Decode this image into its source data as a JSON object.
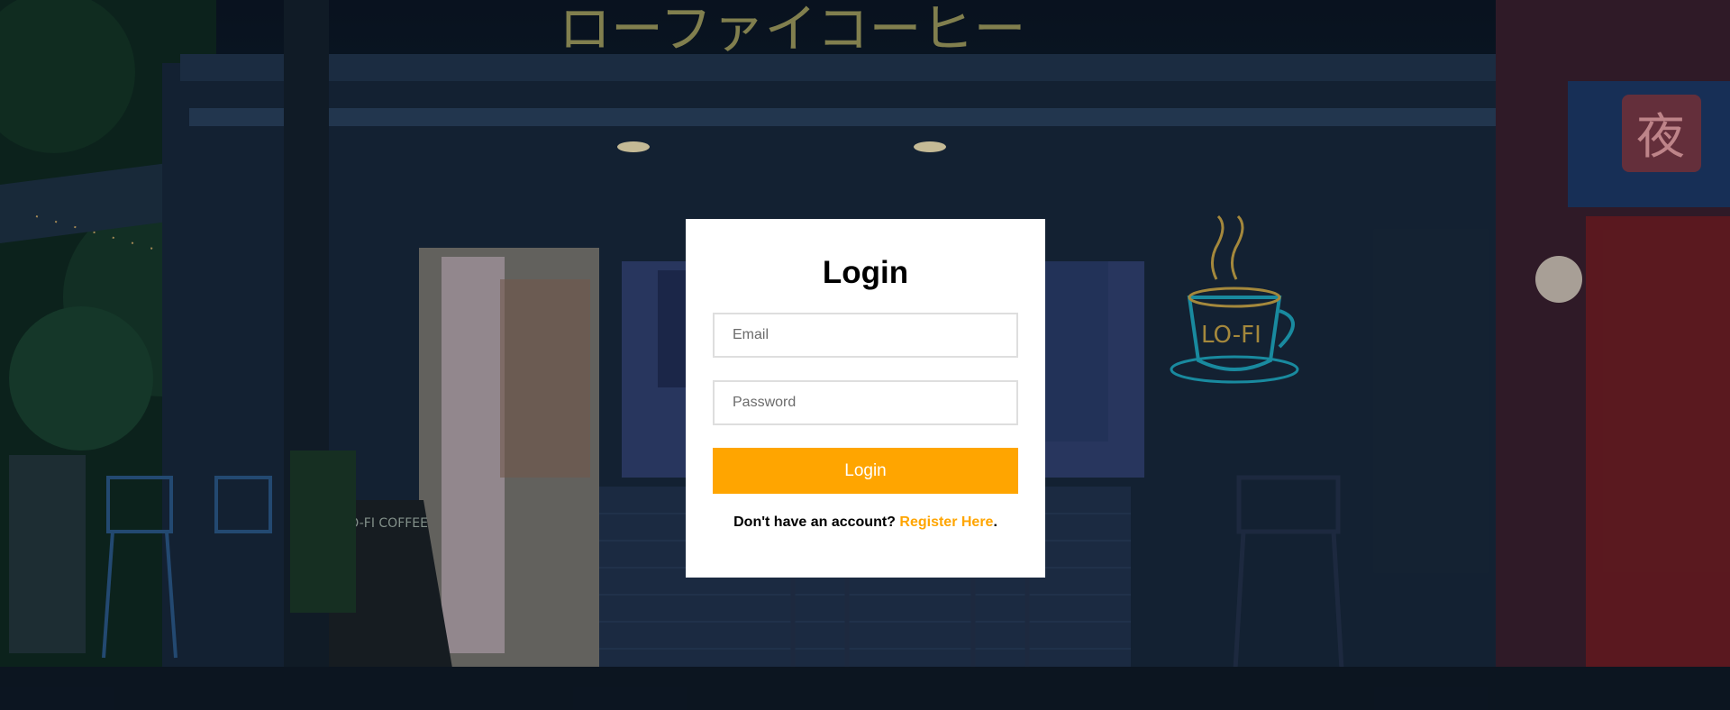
{
  "background": {
    "neon_sign_text": "ローファイコーヒー",
    "window_sign_text": "夜",
    "neon_cup_text": "LO-FI",
    "chalkboard_text": "LO-FI COFFEE",
    "colors": {
      "neon_yellow": "#c9c46a",
      "neon_cyan": "#1fa9c2",
      "neon_pink": "#e8a2a8",
      "wall_blue": "#1d3550",
      "red_wall": "#7a1f26"
    }
  },
  "login": {
    "title": "Login",
    "email_placeholder": "Email",
    "email_value": "",
    "password_placeholder": "Password",
    "password_value": "",
    "button_label": "Login",
    "register_prompt": "Don't have an account? ",
    "register_link": "Register Here",
    "register_suffix": ".",
    "colors": {
      "accent": "#ffa500",
      "card": "#ffffff",
      "border": "#dedede"
    }
  }
}
